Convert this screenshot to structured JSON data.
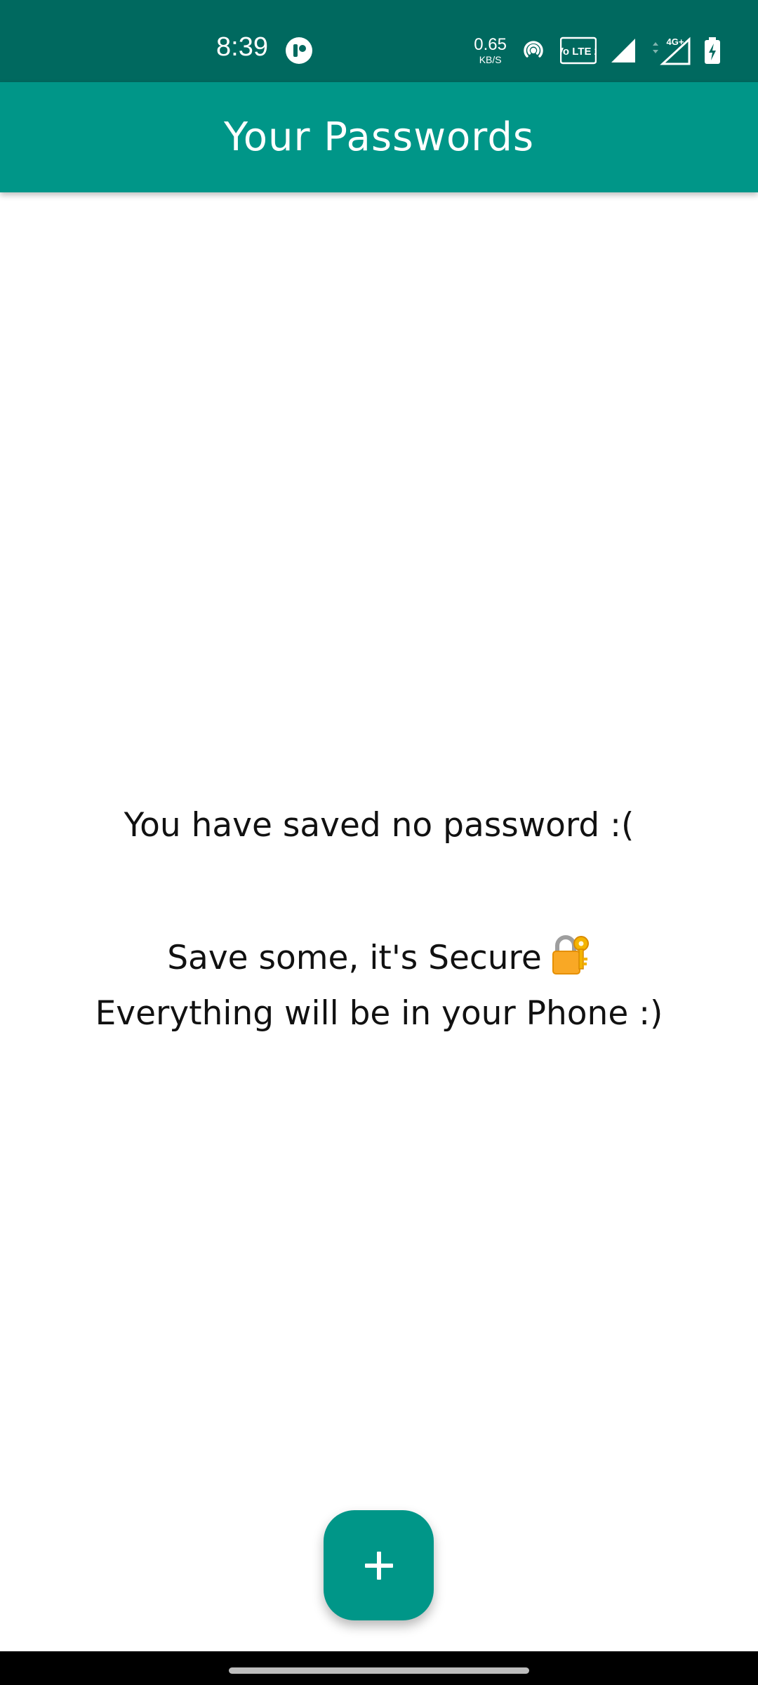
{
  "status_bar": {
    "time": "8:39",
    "network_speed_value": "0.65",
    "network_speed_unit": "KB/S",
    "icons": [
      "app-notification-icon",
      "hotspot-icon",
      "volte-icon",
      "signal-icon",
      "signal-4g-icon",
      "battery-charging-icon"
    ],
    "volte_text": "Vo LTE 2",
    "network_type": "4G+"
  },
  "app_bar": {
    "title": "Your Passwords"
  },
  "empty_state": {
    "line1": "You have saved no password :(",
    "line2": "Save some, it's Secure",
    "line3": "Everything will be in your Phone :)",
    "line2_icon": "lock-with-key-icon"
  },
  "fab": {
    "icon": "plus-icon"
  },
  "colors": {
    "status_bar": "#00695f",
    "primary": "#009688",
    "text": "#111111",
    "background": "#ffffff"
  }
}
